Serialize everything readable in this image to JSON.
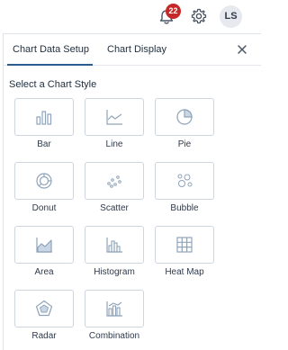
{
  "header": {
    "notification_count": "22",
    "avatar_initials": "LS"
  },
  "panel": {
    "tabs": [
      {
        "label": "Chart Data Setup",
        "active": true
      },
      {
        "label": "Chart Display",
        "active": false
      }
    ],
    "section_title": "Select a Chart Style",
    "chart_styles": [
      {
        "label": "Bar",
        "icon": "bar-chart-icon"
      },
      {
        "label": "Line",
        "icon": "line-chart-icon"
      },
      {
        "label": "Pie",
        "icon": "pie-chart-icon"
      },
      {
        "label": "Donut",
        "icon": "donut-chart-icon"
      },
      {
        "label": "Scatter",
        "icon": "scatter-chart-icon"
      },
      {
        "label": "Bubble",
        "icon": "bubble-chart-icon"
      },
      {
        "label": "Area",
        "icon": "area-chart-icon"
      },
      {
        "label": "Histogram",
        "icon": "histogram-chart-icon"
      },
      {
        "label": "Heat Map",
        "icon": "heat-map-icon"
      },
      {
        "label": "Radar",
        "icon": "radar-chart-icon"
      },
      {
        "label": "Combination",
        "icon": "combination-chart-icon"
      }
    ]
  },
  "colors": {
    "icon_stroke": "#8fa3ba",
    "icon_fill": "#c9d6e4",
    "badge": "#c62828",
    "tab_underline": "#2a5d8f"
  }
}
